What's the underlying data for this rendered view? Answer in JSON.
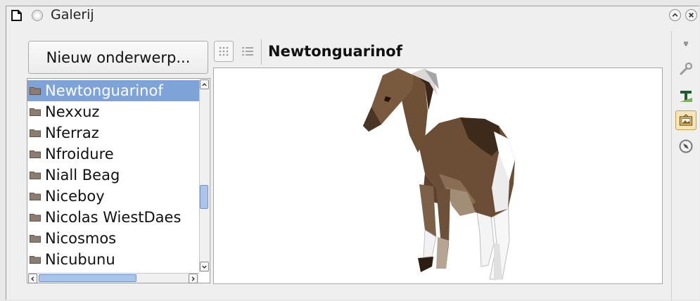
{
  "window": {
    "title": "Galerij"
  },
  "gallery": {
    "new_topic_button": "Nieuw onderwerp...",
    "current_theme": "Newtonguarinof",
    "themes": [
      {
        "label": "Newtonguarinof",
        "selected": true
      },
      {
        "label": "Nexxuz",
        "selected": false
      },
      {
        "label": "Nferraz",
        "selected": false
      },
      {
        "label": "Nfroidure",
        "selected": false
      },
      {
        "label": "Niall Beag",
        "selected": false
      },
      {
        "label": "Niceboy",
        "selected": false
      },
      {
        "label": "Nicolas WiestDaes",
        "selected": false
      },
      {
        "label": "Nicosmos",
        "selected": false
      },
      {
        "label": "Nicubunu",
        "selected": false
      }
    ],
    "view_modes": [
      "icon-view",
      "detail-view"
    ],
    "active_view": "icon-view"
  },
  "sidebar": {
    "tools": [
      "menu-icon",
      "properties-wrench-icon",
      "styles-icon",
      "gallery-icon",
      "navigator-icon"
    ],
    "active_tool": "gallery-icon"
  },
  "colors": {
    "selection": "#7ea3d8",
    "scroll_thumb": "#aac4ea",
    "background": "#efefef"
  }
}
